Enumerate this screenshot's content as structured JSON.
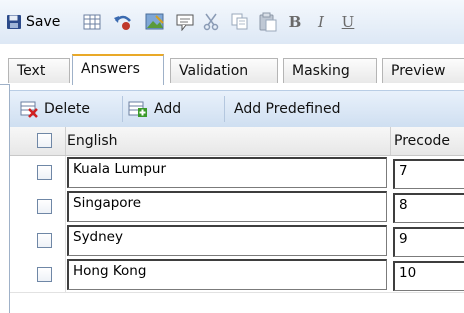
{
  "toolbar": {
    "save_label": "Save",
    "items": [
      "save-icon",
      "table-icon",
      "undo-icon",
      "image-icon",
      "comment-icon",
      "cut-icon",
      "copy-icon",
      "paste-icon",
      "bold",
      "italic",
      "underline"
    ],
    "bold_label": "B",
    "italic_label": "I",
    "underline_label": "U"
  },
  "tabs": [
    {
      "label": "Text",
      "active": false
    },
    {
      "label": "Answers",
      "active": true
    },
    {
      "label": "Validation",
      "active": false
    },
    {
      "label": "Masking",
      "active": false
    },
    {
      "label": "Preview",
      "active": false
    }
  ],
  "grid_toolbar": {
    "delete_label": "Delete",
    "add_label": "Add",
    "add_predefined_label": "Add Predefined"
  },
  "columns": {
    "english": "English",
    "precode": "Precode"
  },
  "rows": [
    {
      "english": "Kuala Lumpur",
      "precode": "7"
    },
    {
      "english": "Singapore",
      "precode": "8"
    },
    {
      "english": "Sydney",
      "precode": "9"
    },
    {
      "english": "Hong Kong",
      "precode": "10"
    }
  ],
  "colors": {
    "toolbar_bg": "#dde8f5",
    "active_tab_accent": "#e9a928",
    "border_blue": "#9fb1c8"
  }
}
